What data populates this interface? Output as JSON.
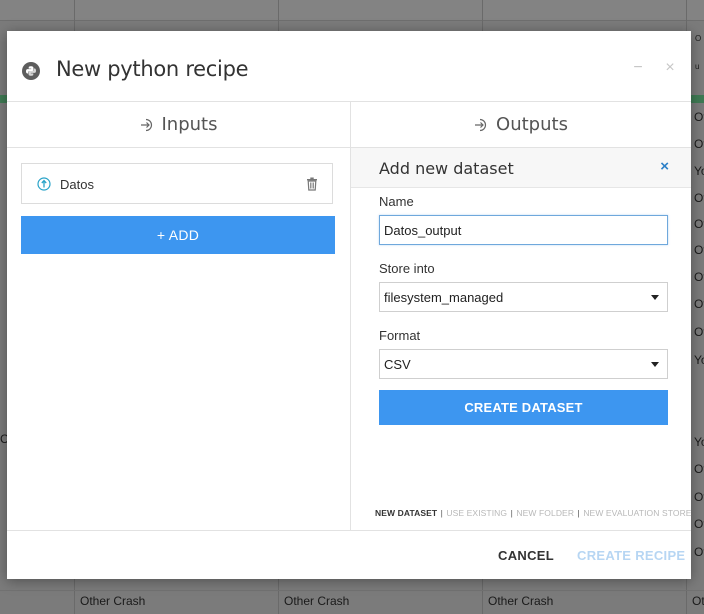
{
  "background": {
    "side_fragments": [
      "O",
      "u",
      "Ot",
      "Ot",
      "Yo",
      "Ot",
      "Ot",
      "Ot",
      "Ot",
      "Ot",
      "Ot",
      "Yo",
      "Yo",
      "Ot",
      "Ot",
      "Ot",
      "Ot"
    ],
    "left_fragment": "Cr",
    "bottom_row": [
      "Other Crash",
      "Other Crash",
      "Other Crash",
      "Ot"
    ]
  },
  "dialog": {
    "title": "New python recipe",
    "minimize_glyph": "−",
    "close_glyph": "×"
  },
  "inputs": {
    "header": "Inputs",
    "items": [
      {
        "label": "Datos"
      }
    ],
    "add_label": "+ ADD"
  },
  "outputs": {
    "header": "Outputs",
    "add_panel_title": "Add new dataset",
    "close_glyph": "×",
    "name_label": "Name",
    "name_value": "Datos_output",
    "store_label": "Store into",
    "store_value": "filesystem_managed",
    "format_label": "Format",
    "format_value": "CSV",
    "create_dataset_label": "CREATE DATASET",
    "mode_links": {
      "new_dataset": "NEW DATASET",
      "use_existing": "USE EXISTING",
      "new_folder": "NEW FOLDER",
      "new_evaluation_store": "NEW EVALUATION STORE",
      "separator": "|"
    }
  },
  "footer": {
    "cancel_label": "CANCEL",
    "create_recipe_label": "CREATE RECIPE"
  },
  "colors": {
    "accent": "#3d96f0",
    "disabled_accent": "#b7d6f3",
    "close_blue": "#2c80c8"
  }
}
